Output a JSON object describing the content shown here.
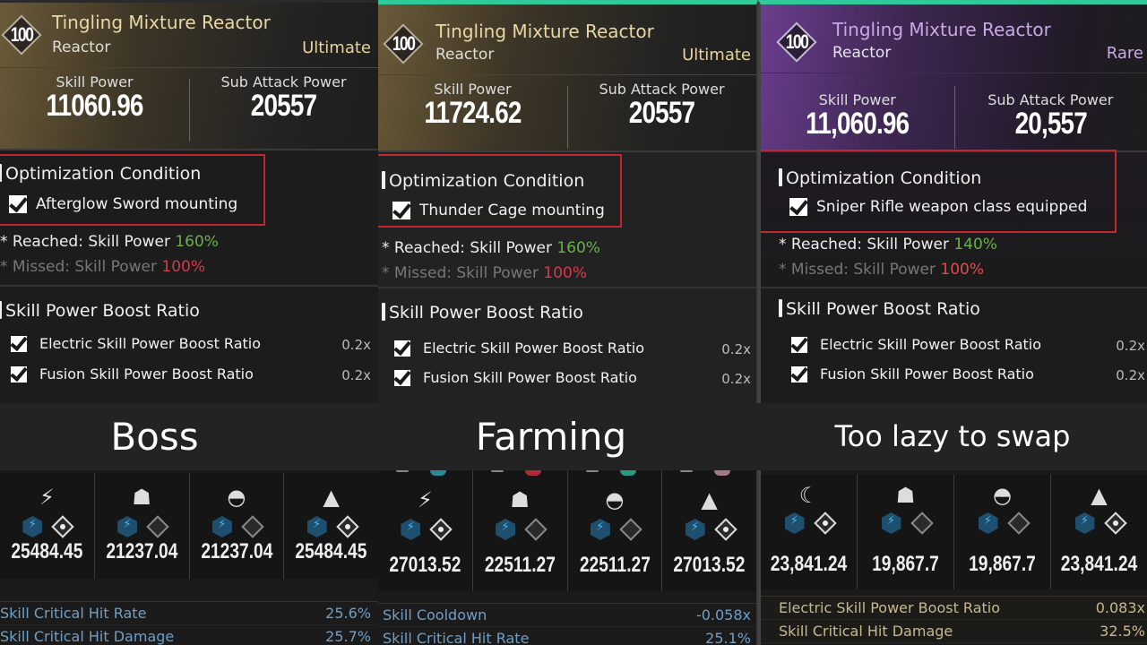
{
  "captions": [
    "Boss",
    "Farming",
    "Too lazy to swap"
  ],
  "panels": [
    {
      "level": "100",
      "title": "Tingling Mixture Reactor",
      "type": "Reactor",
      "grade": "Ultimate",
      "stats": {
        "skill_power_label": "Skill Power",
        "skill_power": "11060.96",
        "sub_attack_label": "Sub Attack Power",
        "sub_attack": "20557"
      },
      "optimization": {
        "heading": "Optimization Condition",
        "condition": "Afterglow Sword mounting",
        "reached_label": "* Reached: Skill Power ",
        "reached_value": "160%",
        "missed_label": "* Missed: Skill Power ",
        "missed_value": "100%"
      },
      "boost": {
        "heading": "Skill Power Boost Ratio",
        "items": [
          {
            "label": "Electric Skill Power Boost Ratio",
            "value": "0.2x"
          },
          {
            "label": "Fusion Skill Power Boost Ratio",
            "value": "0.2x"
          }
        ]
      },
      "modules": [
        {
          "icon": "slash-lightning-icon",
          "glyph": "⚡",
          "value": "25484.45"
        },
        {
          "icon": "helmet-icon",
          "glyph": "☗",
          "value": "21237.04"
        },
        {
          "icon": "dome-icon",
          "glyph": "◓",
          "value": "21237.04"
        },
        {
          "icon": "triangle-icon",
          "glyph": "▲",
          "value": "25484.45"
        }
      ],
      "substats": [
        {
          "label": "Skill Critical Hit Rate",
          "value": "25.6%"
        },
        {
          "label": "Skill Critical Hit Damage",
          "value": "25.7%"
        }
      ]
    },
    {
      "level": "100",
      "title": "Tingling Mixture Reactor",
      "type": "Reactor",
      "grade": "Ultimate",
      "stats": {
        "skill_power_label": "Skill Power",
        "skill_power": "11724.62",
        "sub_attack_label": "Sub Attack Power",
        "sub_attack": "20557"
      },
      "optimization": {
        "heading": "Optimization Condition",
        "condition": "Thunder Cage mounting",
        "reached_label": "* Reached: Skill Power ",
        "reached_value": "160%",
        "missed_label": "* Missed: Skill Power ",
        "missed_value": "100%"
      },
      "boost": {
        "heading": "Skill Power Boost Ratio",
        "items": [
          {
            "label": "Electric Skill Power Boost Ratio",
            "value": "0.2x"
          },
          {
            "label": "Fusion Skill Power Boost Ratio",
            "value": "0.2x"
          }
        ]
      },
      "modules": [
        {
          "icon": "slash-lightning-icon",
          "glyph": "⚡",
          "value": "27013.52"
        },
        {
          "icon": "helmet-icon",
          "glyph": "☗",
          "value": "22511.27"
        },
        {
          "icon": "dome-icon",
          "glyph": "◓",
          "value": "22511.27"
        },
        {
          "icon": "triangle-icon",
          "glyph": "▲",
          "value": "27013.52"
        }
      ],
      "substats": [
        {
          "label": "Skill Cooldown",
          "value": "-0.058x"
        },
        {
          "label": "Skill Critical Hit Rate",
          "value": "25.1%"
        }
      ]
    },
    {
      "level": "100",
      "title": "Tingling Mixture Reactor",
      "type": "Reactor",
      "grade": "Rare",
      "stats": {
        "skill_power_label": "Skill Power",
        "skill_power": "11,060.96",
        "sub_attack_label": "Sub Attack Power",
        "sub_attack": "20,557"
      },
      "optimization": {
        "heading": "Optimization Condition",
        "condition": "Sniper Rifle weapon class equipped",
        "reached_label": "* Reached: Skill Power ",
        "reached_value": "140%",
        "missed_label": "* Missed: Skill Power ",
        "missed_value": "100%"
      },
      "boost": {
        "heading": "Skill Power Boost Ratio",
        "items": [
          {
            "label": "Electric Skill Power Boost Ratio",
            "value": "0.2x"
          },
          {
            "label": "Fusion Skill Power Boost Ratio",
            "value": "0.2x"
          }
        ]
      },
      "modules": [
        {
          "icon": "crescent-icon",
          "glyph": "☾",
          "value": "23,841.24"
        },
        {
          "icon": "helmet-icon",
          "glyph": "☗",
          "value": "19,867.7"
        },
        {
          "icon": "dome-lightning-icon",
          "glyph": "◓",
          "value": "19,867.7"
        },
        {
          "icon": "triangle-icon",
          "glyph": "▲",
          "value": "23,841.24"
        }
      ],
      "substats": [
        {
          "label": "Electric Skill Power Boost Ratio",
          "value": "0.083x"
        },
        {
          "label": "Skill Critical Hit Damage",
          "value": "32.5%"
        }
      ]
    }
  ],
  "colors": {
    "accent_top": "#2fc99a",
    "ultimate_gold": "#e7d397",
    "rare_purple": "#c9a8e6",
    "highlight_red": "#c0282f",
    "reached_green": "#6ab04c",
    "missed_red": "#d23b4a",
    "electric_blue": "#4fb6ea"
  }
}
